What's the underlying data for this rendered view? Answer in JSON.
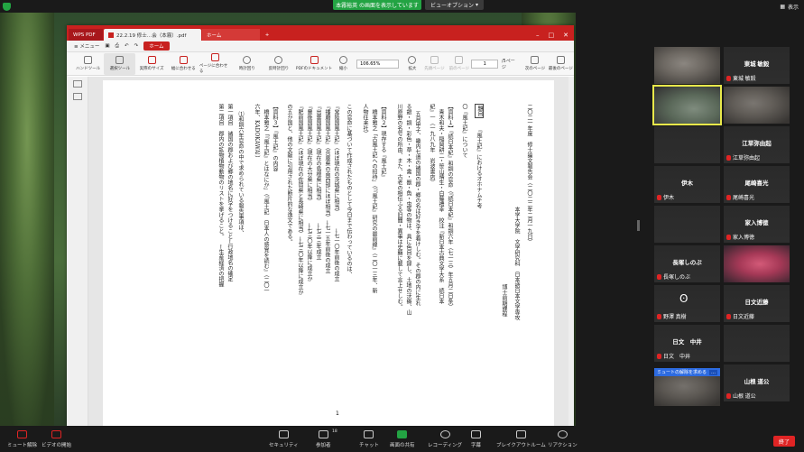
{
  "zoom": {
    "share_banner": "本霧裕英 の画面を表示しています",
    "view_options": "ビューオプション",
    "view_top_right": "表示",
    "toolbar": {
      "mute": "ミュート解除",
      "video": "ビデオの開始",
      "security": "セキュリティ",
      "participants": "参加者",
      "participants_count": "18",
      "chat": "チャット",
      "share": "画面の共有",
      "record": "レコーディング",
      "captions": "字幕",
      "breakout": "ブレイクアウトルーム",
      "reactions": "リアクション",
      "end": "終了"
    },
    "unmute_request": "ミュートの解除を求める",
    "unmute_more": "…"
  },
  "wps": {
    "tabs": {
      "logo": "WPS PDF",
      "active": "22.2.19 修士…会（本霧）.pdf",
      "home": "ホーム",
      "plus": "+"
    },
    "menu": {
      "menu_label": "≡ メニュー",
      "home": "ホーム"
    },
    "tools": [
      "ハンドツール",
      "選択ツール",
      "実際のサイズ",
      "幅に合わせる",
      "ページに合わせる",
      "時計回り",
      "反時計回り",
      "PDFのドキュメント"
    ],
    "zoom_out": "縮小",
    "zoom_in": "拡大",
    "zoom_value": "106.65%",
    "first_page": "先頭ページ",
    "prev_page": "前のページ",
    "page_current": "1",
    "page_total": "/5ページ",
    "next_page": "次のページ",
    "last_page": "最後のページ"
  },
  "doc": {
    "col_date": "二〇二一年度　修士論文報告会（二〇二二年二月一九日）",
    "col_affil": "本学大学院　文学研究科　日本語日本文学専攻",
    "col_author": "博士前期課程",
    "col_title_box": "題目",
    "col_title": "『風土記』におけるオホナムチ考",
    "col_h1": "〇『風土記』について",
    "col_ref1": "【資料１】『続日本紀』和銅の官命（『続日本紀』和銅六年（七一三）年五月二日条）",
    "col_ref1b": "　青木和夫・稲岡耕二・笹山晴生・白藤禮幸　校注『新日本古典文学大系　続日本",
    "col_ref1c": "紀』一（一九八九年　岩波書店）",
    "col_body1": "五月甲子、畿内七道の諸国の郡・郷の名は好き字を着けしむ。その郡の内に生れ",
    "col_body2": "る銀・銅・彩色・草・木・禽・獣・魚・虫等の物は、具に色目を録し、土地の沃瘠、山",
    "col_body3": "川原野の名号の所由、また、古老の相伝ふる旧聞・異事は史籍に載して言上せしむ。",
    "col_ref2": "【資料２】現存する『風土記』",
    "col_ref2b": "　橋本雅之「古風土記への招待」（『『風土記』研究の最前線』（二〇一三年、新",
    "col_ref2c": "人物往来社）",
    "col_body4": "この官命に基づいて作成されたものとして今日まで伝わっているのは、",
    "col_list1": "『常陸国風土記』（ほぼ現在の茨城県に相当）　　　→七一〇年前後の成立",
    "col_list2": "『播磨国風土記』（兵庫県の南西部にほぼ相当）→七一五年前後の成立",
    "col_list3": "『出雲国風土記』（現在の島根県に相当）　　　　→七三三年成立",
    "col_list4": "『豊後国風土記』（現在の大分県に相当）　　　　→七三〇年以降に成立か",
    "col_list5": "『肥前国風土記』（ほぼ現在の佐賀県と長崎県に相当）→七三〇年以降に成立か",
    "col_body5": "の五か国と、他の文献に引用された断片的な逸文である。",
    "col_ref3": "【資料３】『風土記』の内容",
    "col_ref3b": "　橋本雅之「『風土記』とはなにか」（『風土記　日本人の感覚を読む』（二〇一",
    "col_ref3c": "六年、KADOKAWA））",
    "col_item": "⑴和銅六年官命の中で求められている報告事項は、",
    "col_item1": "第一項目　諸国の郡および郷の地名に好字をつけること←行政地名の確定",
    "col_item2": "第二項目　郡内の鉱物植物動物のリストを挙げること。　←生産経済の把握",
    "page_num": "1"
  },
  "participants": [
    {
      "big": "",
      "name": ""
    },
    {
      "big": "東城 敏毅",
      "name": "東城 敏毅"
    },
    {
      "big": "",
      "name": ""
    },
    {
      "big": "",
      "name": ""
    },
    {
      "big": "",
      "name": ""
    },
    {
      "big": "江草弥由起",
      "name": "江草弥由起"
    },
    {
      "big": "伊木",
      "name": "伊木"
    },
    {
      "big": "尾崎喜光",
      "name": "尾崎喜光"
    },
    {
      "big": "",
      "name": ""
    },
    {
      "big": "家入博徳",
      "name": "家入博徳"
    },
    {
      "big": "長塚しのぶ",
      "name": "長塚しのぶ"
    },
    {
      "big": "",
      "name": ""
    },
    {
      "big": "",
      "name": "野澤 真樹"
    },
    {
      "big": "日文近藤",
      "name": "日文近藤"
    },
    {
      "big": "日文　中井",
      "name": "日文　中井"
    },
    {
      "big": "",
      "name": ""
    },
    {
      "big": "",
      "name": ""
    },
    {
      "big": "山根 道公",
      "name": "山根 道公"
    }
  ]
}
